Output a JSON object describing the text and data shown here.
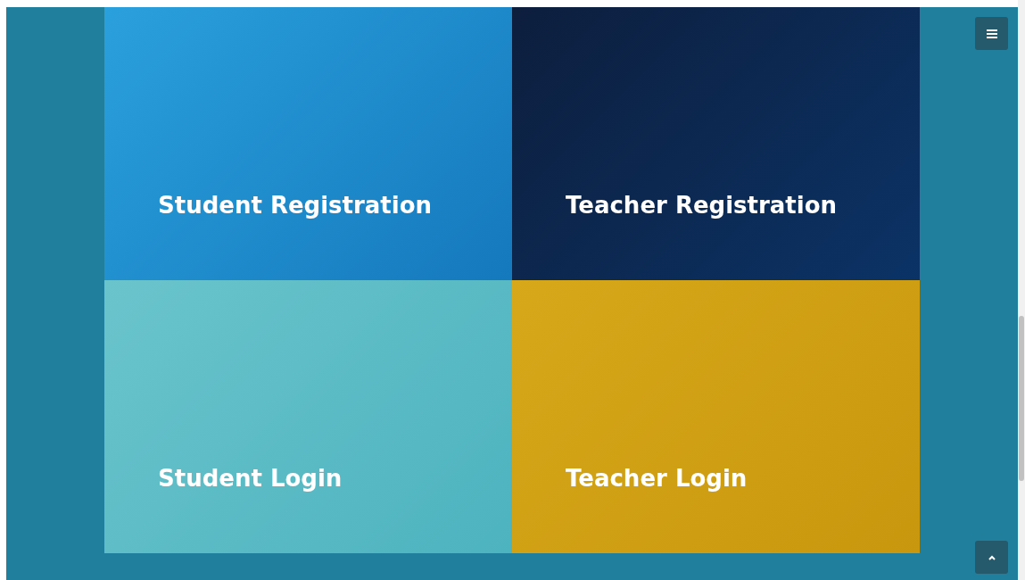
{
  "tiles": [
    {
      "title": "Student Registration"
    },
    {
      "title": "Teacher Registration"
    },
    {
      "title": "Student Login"
    },
    {
      "title": "Teacher Login"
    }
  ]
}
